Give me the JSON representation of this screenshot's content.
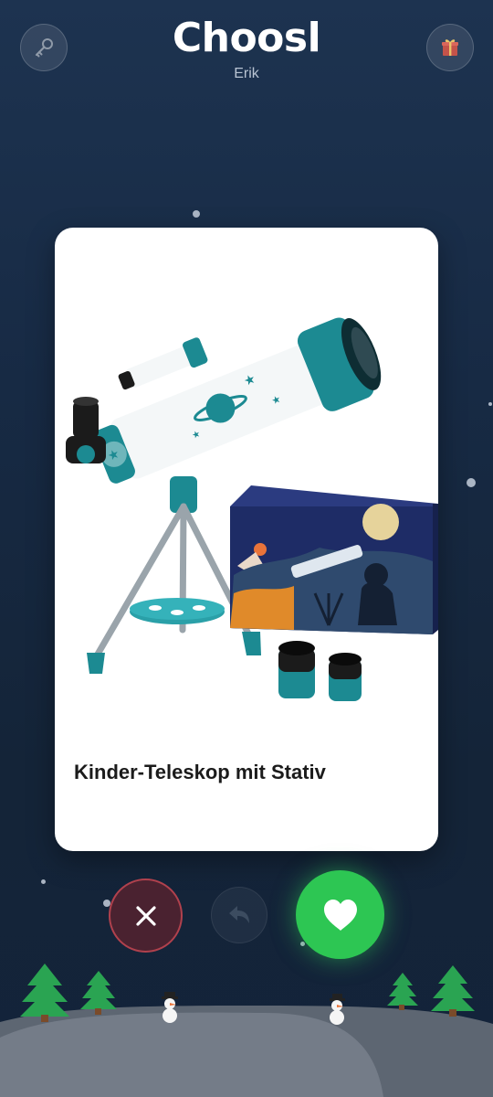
{
  "header": {
    "app_title": "Choosl",
    "user_name": "Erik",
    "left_icon": "key-icon",
    "right_icon": "gift-icon"
  },
  "card": {
    "title": "Kinder-Teleskop mit Stativ",
    "image": "telescope-product-image"
  },
  "actions": {
    "dislike_icon": "close-icon",
    "undo_icon": "undo-icon",
    "like_icon": "heart-icon"
  },
  "colors": {
    "background": "#172a44",
    "like": "#2dc653",
    "dislike_border": "#b0414d",
    "telescope_accent": "#1c8a92"
  }
}
